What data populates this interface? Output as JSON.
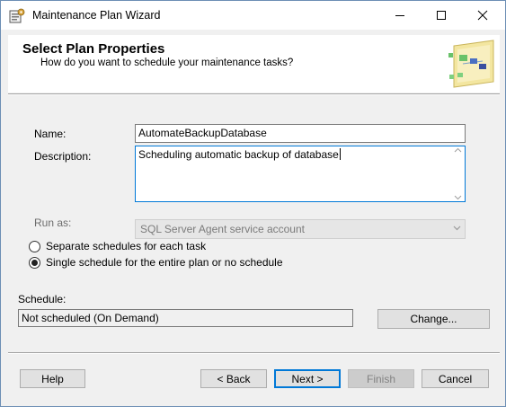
{
  "window": {
    "title": "Maintenance Plan Wizard"
  },
  "header": {
    "title": "Select Plan Properties",
    "subtitle": "How do you want to schedule your maintenance tasks?"
  },
  "form": {
    "name_label": "Name:",
    "name_value": "AutomateBackupDatabase",
    "description_label": "Description:",
    "description_value": "Scheduling automatic backup of database",
    "run_as_label": "Run as:",
    "run_as_value": "SQL Server Agent service account",
    "radio_separate_label": "Separate schedules for each task",
    "radio_single_label": "Single schedule for the entire plan or no schedule",
    "selected_option": "single",
    "schedule_label": "Schedule:",
    "schedule_value": "Not scheduled (On Demand)",
    "change_button": "Change..."
  },
  "buttons": {
    "help": "Help",
    "back": "< Back",
    "next": "Next >",
    "finish": "Finish",
    "cancel": "Cancel"
  },
  "colors": {
    "accent": "#0078d7",
    "window_bg": "#f0f0f0"
  },
  "icons": {
    "app": "maintenance-plan-icon",
    "header": "wizard-banner-icon"
  }
}
